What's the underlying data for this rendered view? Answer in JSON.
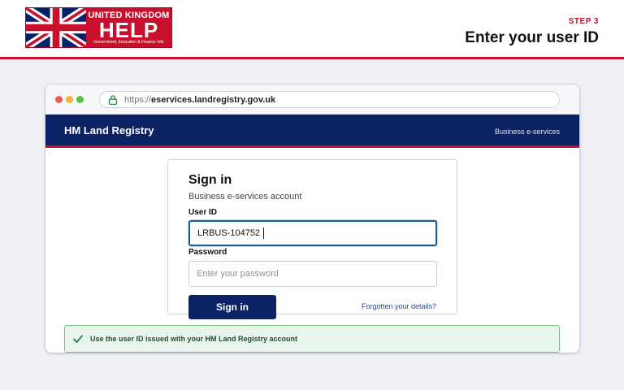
{
  "header": {
    "logo": {
      "line1": "UNITED KINGDOM",
      "line2": "HELP",
      "line3": "Government, Education & Finance Info"
    },
    "step_label": "STEP 3",
    "step_title": "Enter your user ID"
  },
  "browser": {
    "url_protocol": "https://",
    "url_host": "eservices.landregistry.gov.uk"
  },
  "site": {
    "name": "HM Land Registry",
    "service": "Business e-services"
  },
  "signin": {
    "title": "Sign in",
    "subtitle": "Business e-services account",
    "user_label": "User ID",
    "user_value": "LRBUS-104752",
    "password_label": "Password",
    "password_placeholder": "Enter your password",
    "button_label": "Sign in",
    "forgot_label": "Forgotten your details?"
  },
  "hint": {
    "text": "Use the user ID issued with your HM Land Registry account"
  },
  "colors": {
    "brand_red": "#c8102e",
    "brand_navy": "#0b2265",
    "focus_blue": "#1d5c8f",
    "success_green": "#2e8b4a"
  }
}
